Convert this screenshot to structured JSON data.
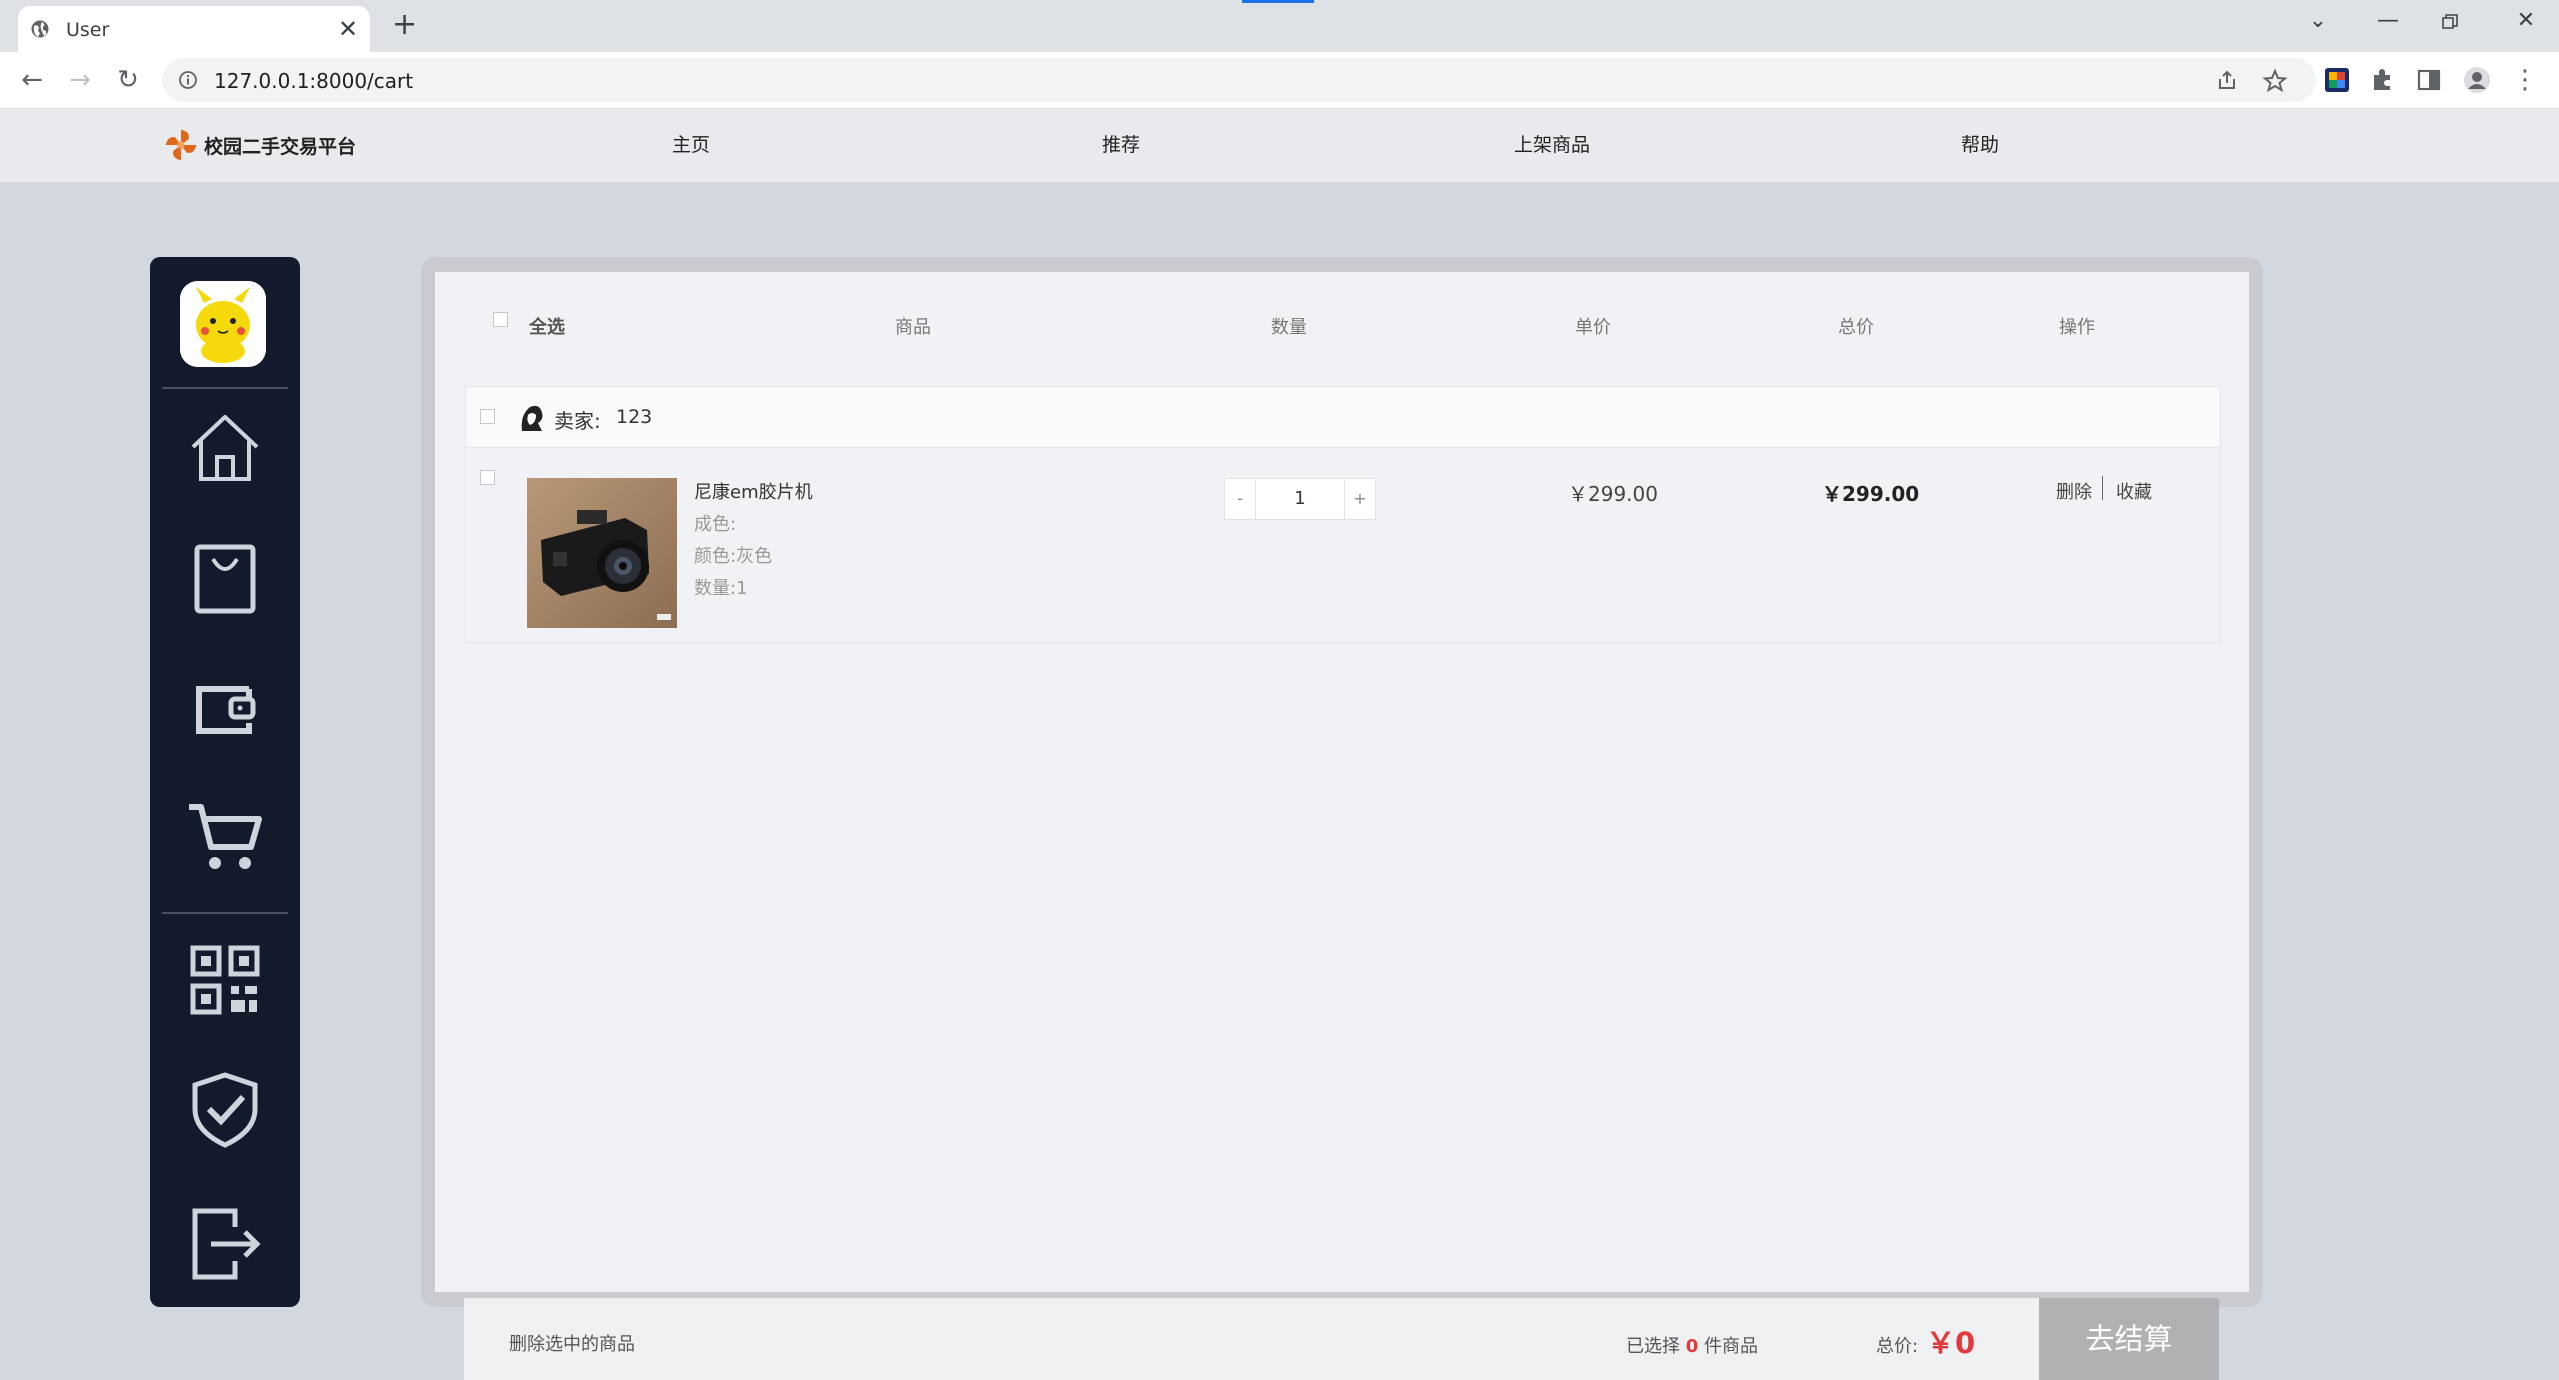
{
  "browser": {
    "tab_title": "User",
    "url": "127.0.0.1:8000/cart"
  },
  "site": {
    "logo_text": "校园二手交易平台",
    "nav": [
      "主页",
      "推荐",
      "上架商品",
      "帮助"
    ]
  },
  "sidebar": {
    "icons": [
      "home-icon",
      "shopping-bag-icon",
      "wallet-icon",
      "cart-icon",
      "qr-code-icon",
      "shield-check-icon",
      "logout-icon"
    ]
  },
  "cart": {
    "header": {
      "select_all": "全选",
      "product": "商品",
      "quantity": "数量",
      "unit_price": "单价",
      "total_price": "总价",
      "actions": "操作"
    },
    "seller": {
      "label": "卖家:",
      "name": "123"
    },
    "item": {
      "name": "尼康em胶片机",
      "condition": "成色:",
      "color": "颜色:灰色",
      "count": "数量:1",
      "qty_minus": "-",
      "qty_value": "1",
      "qty_plus": "+",
      "unit_price": "￥299.00",
      "total_price": "￥299.00",
      "delete": "删除",
      "favorite": "收藏"
    },
    "footer": {
      "delete_selected": "删除选中的商品",
      "selected_prefix": "已选择",
      "selected_count": "0",
      "selected_suffix": "件商品",
      "total_label": "总价:",
      "total_value": "￥0",
      "checkout": "去结算"
    }
  },
  "colors": {
    "sidebar_bg": "#131a2c",
    "price_red": "#e4393c",
    "checkout_bg": "#b0b1b3"
  }
}
